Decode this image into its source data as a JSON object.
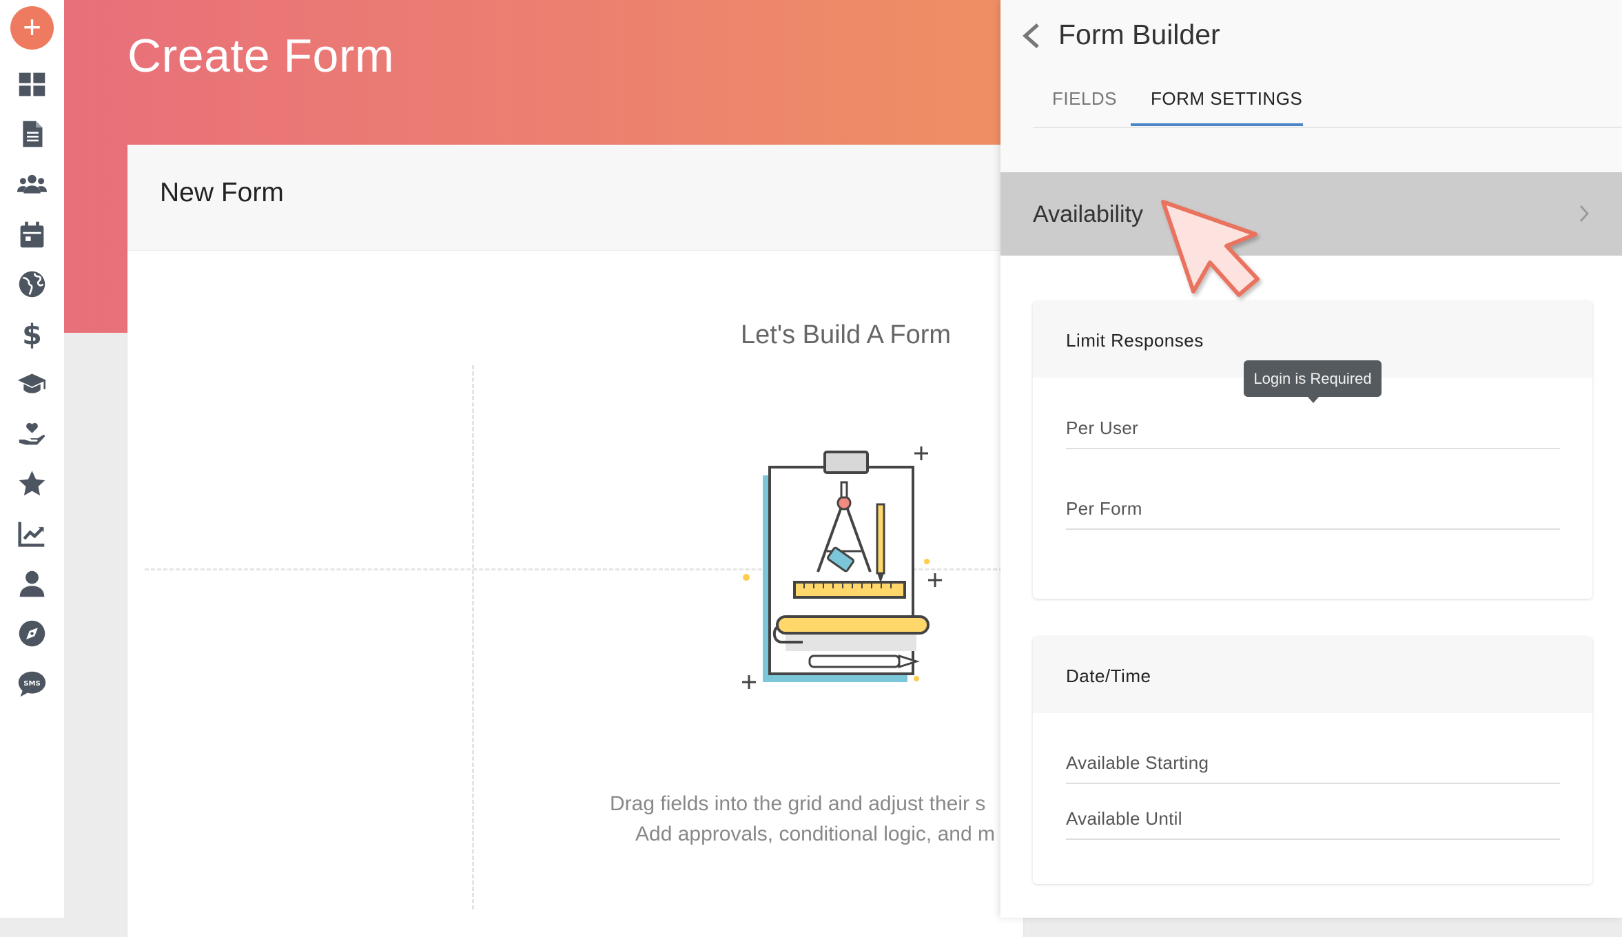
{
  "sidebar": {
    "add_symbol": "+",
    "items": [
      {
        "icon": "dashboard-icon"
      },
      {
        "icon": "document-icon"
      },
      {
        "icon": "users-icon"
      },
      {
        "icon": "calendar-icon"
      },
      {
        "icon": "globe-icon"
      },
      {
        "icon": "dollar-icon"
      },
      {
        "icon": "graduation-cap-icon"
      },
      {
        "icon": "hand-heart-icon"
      },
      {
        "icon": "star-icon"
      },
      {
        "icon": "chart-icon"
      },
      {
        "icon": "user-icon"
      },
      {
        "icon": "compass-icon"
      },
      {
        "icon": "sms-icon"
      }
    ]
  },
  "header": {
    "title": "Create Form"
  },
  "card": {
    "title": "New Form",
    "empty_title": "Let's Build A Form",
    "description_line1": "Drag fields into the grid and adjust their s",
    "description_line2": "Add approvals, conditional logic, and m"
  },
  "panel": {
    "title": "Form Builder",
    "tabs": [
      {
        "label": "FIELDS",
        "active": false
      },
      {
        "label": "FORM SETTINGS",
        "active": true
      }
    ],
    "availability_label": "Availability",
    "sections": [
      {
        "title": "Limit Responses",
        "fields": [
          "Per User",
          "Per Form"
        ]
      },
      {
        "title": "Date/Time",
        "fields": [
          "Available Starting",
          "Available Until"
        ]
      }
    ],
    "tooltip": "Login is Required"
  },
  "colors": {
    "accent": "#ee7b60",
    "tab_underline": "#4a86c8",
    "gradient_start": "#e8707a",
    "gradient_end": "#ef8f64",
    "sidebar_icon": "#4d5561"
  }
}
